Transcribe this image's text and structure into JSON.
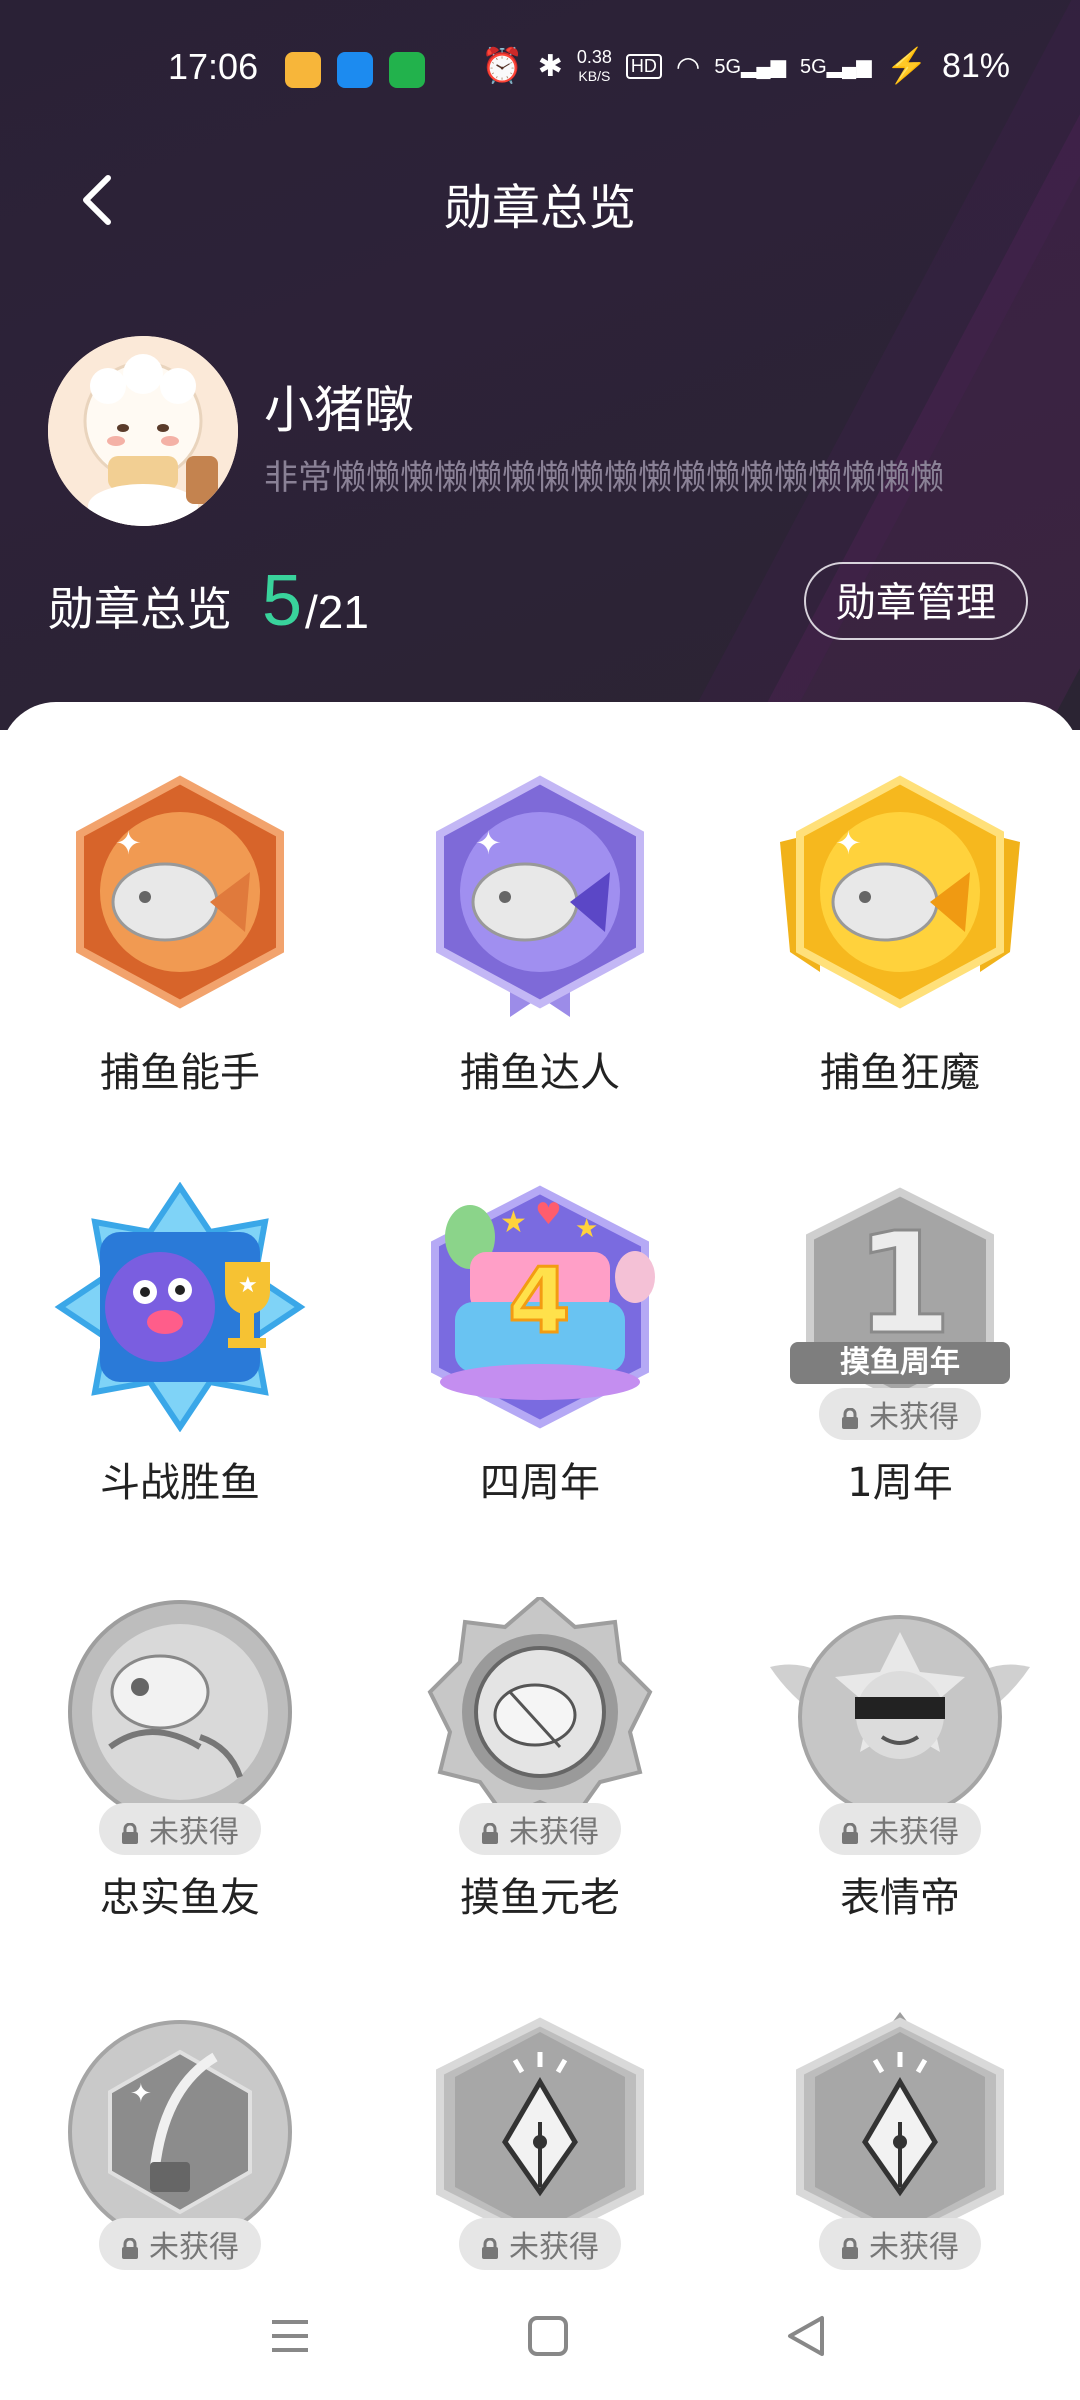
{
  "status_bar": {
    "time": "17:06",
    "net_speed_value": "0.38",
    "net_speed_unit": "KB/S",
    "hd": "HD",
    "signal1": "5G",
    "signal2": "5G",
    "battery": "81%"
  },
  "header": {
    "title": "勋章总览"
  },
  "profile": {
    "username": "小猪暾",
    "bio": "非常懒懒懒懒懒懒懒懒懒懒懒懒懒懒懒懒懒懒"
  },
  "summary": {
    "label": "勋章总览",
    "earned": "5",
    "total": "/21",
    "manage_button": "勋章管理"
  },
  "medals": [
    {
      "name": "捕鱼能手",
      "locked": false,
      "color": "#e07a3c"
    },
    {
      "name": "捕鱼达人",
      "locked": false,
      "color": "#8f7be0"
    },
    {
      "name": "捕鱼狂魔",
      "locked": false,
      "color": "#f6b81e"
    },
    {
      "name": "斗战胜鱼",
      "locked": false,
      "color": "#3aa7e8"
    },
    {
      "name": "四周年",
      "locked": false,
      "color": "#7a6be0"
    },
    {
      "name": "1周年",
      "locked": true,
      "lock_text": "未获得"
    },
    {
      "name": "忠实鱼友",
      "locked": true,
      "lock_text": "未获得"
    },
    {
      "name": "摸鱼元老",
      "locked": true,
      "lock_text": "未获得"
    },
    {
      "name": "表情帝",
      "locked": true,
      "lock_text": "未获得"
    },
    {
      "name": "",
      "locked": true,
      "lock_text": "未获得"
    },
    {
      "name": "",
      "locked": true,
      "lock_text": "未获得"
    },
    {
      "name": "",
      "locked": true,
      "lock_text": "未获得"
    }
  ],
  "medal_art_text": {
    "anniversary_banner": "摸鱼周年",
    "anniversary_number": "1",
    "four_year_number": "4"
  },
  "colors": {
    "accent_green": "#39d39c",
    "header_bg": "#2b2234"
  }
}
